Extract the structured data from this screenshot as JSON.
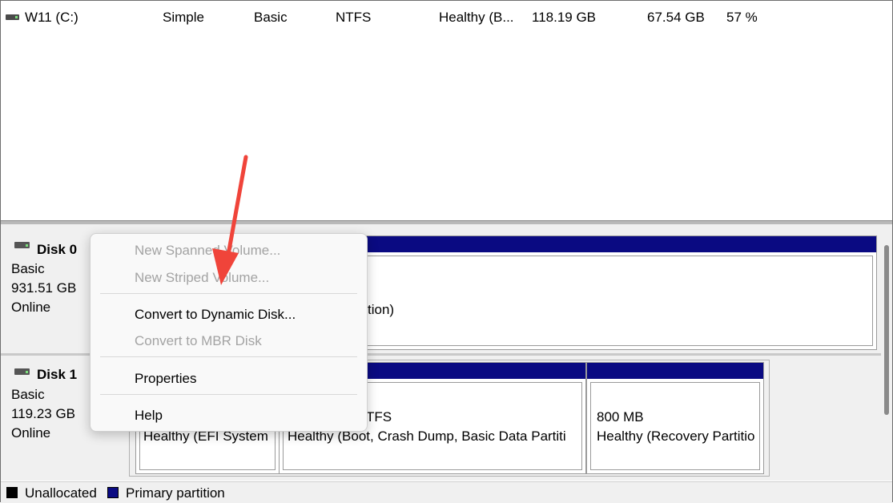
{
  "volume_list": {
    "row": {
      "name": "W11 (C:)",
      "layout": "Simple",
      "type": "Basic",
      "file_system": "NTFS",
      "status": "Healthy (B...",
      "capacity": "118.19 GB",
      "free_space": "67.54 GB",
      "percent_free": "57 %"
    }
  },
  "disks": [
    {
      "title": "Disk 0",
      "type": "Basic",
      "size": "931.51 GB",
      "state": "Online",
      "partitions": [
        {
          "line2": "tion)"
        }
      ]
    },
    {
      "title": "Disk 1",
      "type": "Basic",
      "size": "119.23 GB",
      "state": "Online",
      "partitions": [
        {
          "line1": "",
          "line2": "Healthy (EFI System"
        },
        {
          "line1": "TFS",
          "line2": "Healthy (Boot, Crash Dump, Basic Data Partiti"
        },
        {
          "line1": "800 MB",
          "line2": "Healthy (Recovery Partitio"
        }
      ]
    }
  ],
  "context_menu": {
    "items": [
      {
        "label": "New Spanned Volume...",
        "enabled": false
      },
      {
        "label": "New Striped Volume...",
        "enabled": false
      },
      {
        "label": "Convert to Dynamic Disk...",
        "enabled": true
      },
      {
        "label": "Convert to MBR Disk",
        "enabled": false
      },
      {
        "label": "Properties",
        "enabled": true
      },
      {
        "label": "Help",
        "enabled": true
      }
    ]
  },
  "legend": {
    "unallocated": "Unallocated",
    "primary": "Primary partition",
    "unallocated_color": "#000000",
    "primary_color": "#0a0a82"
  },
  "colors": {
    "partition_bar": "#0a0a82",
    "annotation_arrow": "#f0443a"
  }
}
